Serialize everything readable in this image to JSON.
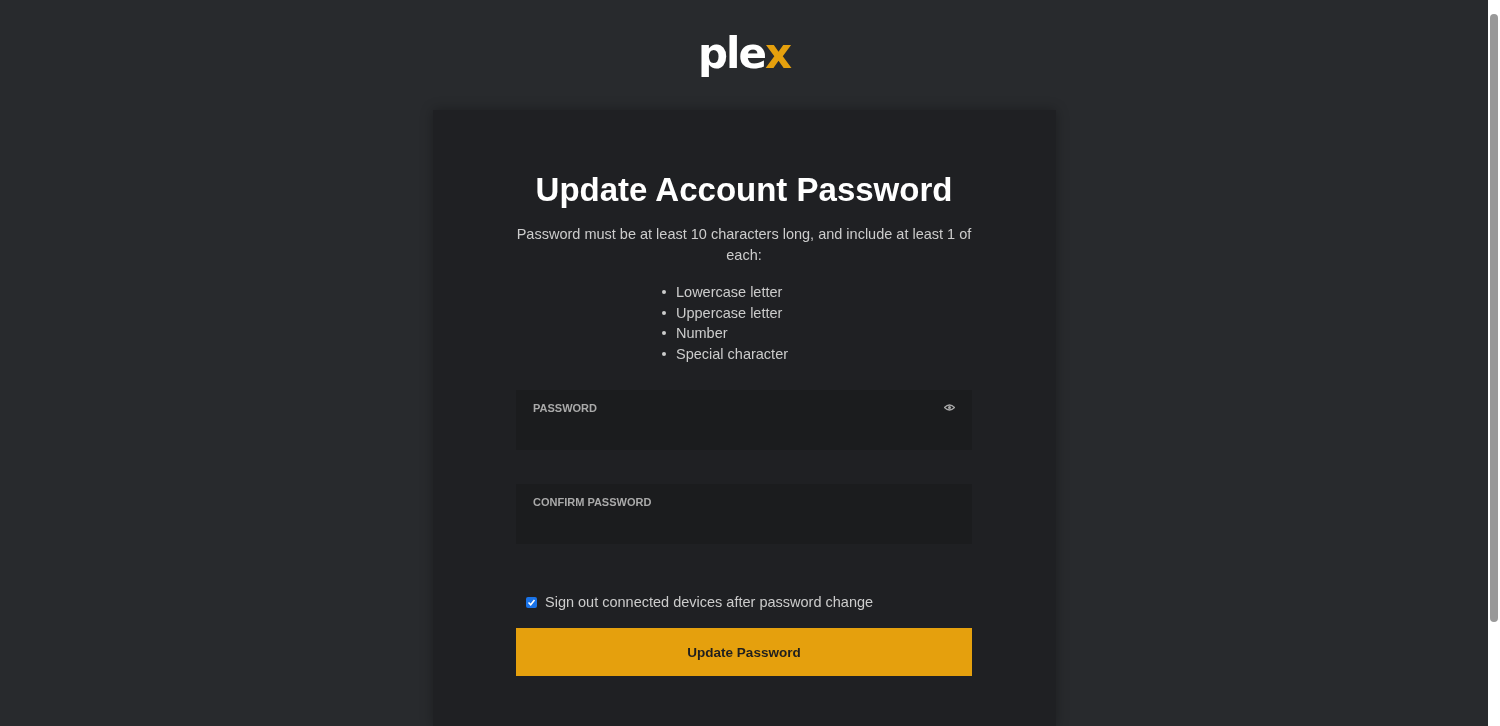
{
  "logo": {
    "text": "ple",
    "accent": "x"
  },
  "title": "Update Account Password",
  "intro": "Password must be at least 10 characters long, and include at least 1 of each:",
  "requirements": [
    "Lowercase letter",
    "Uppercase letter",
    "Number",
    "Special character"
  ],
  "fields": [
    {
      "label": "PASSWORD",
      "reveal": true
    },
    {
      "label": "CONFIRM PASSWORD",
      "reveal": false
    }
  ],
  "signout": {
    "label": "Sign out connected devices after password change",
    "checked": true
  },
  "button": "Update Password"
}
